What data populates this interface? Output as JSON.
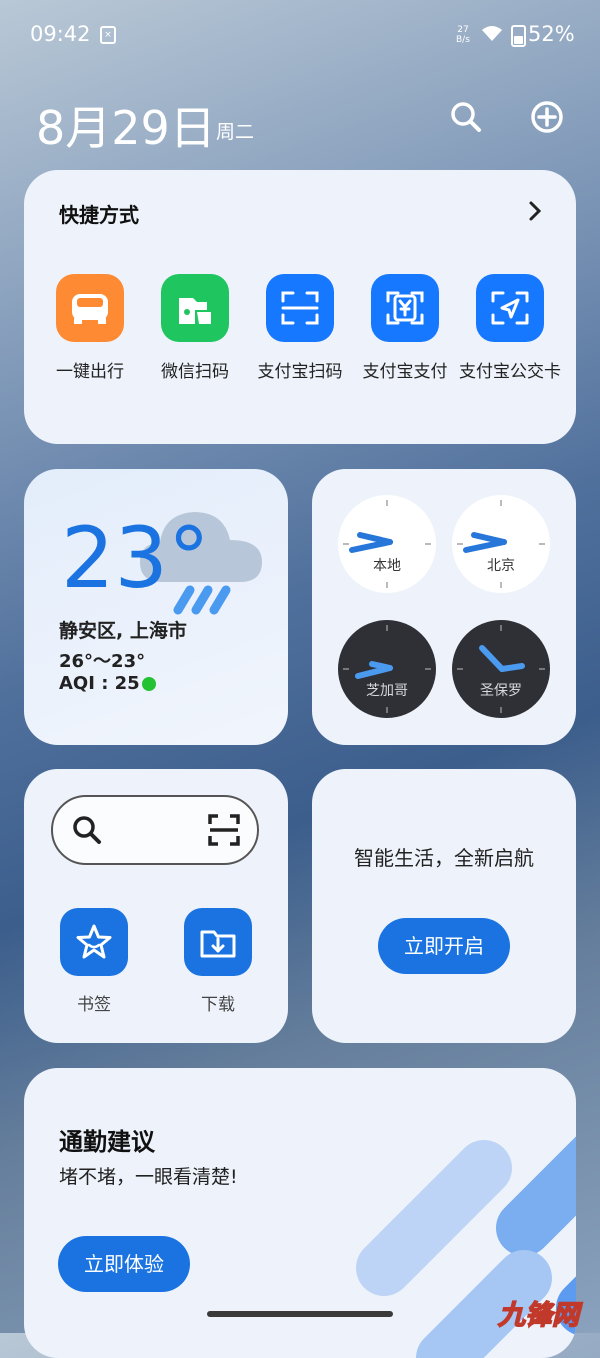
{
  "status_bar": {
    "time": "09:42",
    "speed_value": "27",
    "speed_unit": "B/s",
    "battery": "52%"
  },
  "header": {
    "date": "8月29日",
    "weekday": "周二",
    "search_icon": "search-icon",
    "add_icon": "add-circle-icon"
  },
  "shortcuts": {
    "title": "快捷方式",
    "items": [
      {
        "label": "一键出行",
        "icon": "car-icon",
        "color": "#ff8a34"
      },
      {
        "label": "微信扫码",
        "icon": "wechat-scan-icon",
        "color": "#1fc660"
      },
      {
        "label": "支付宝扫码",
        "icon": "scan-icon",
        "color": "#1677ff"
      },
      {
        "label": "支付宝支付",
        "icon": "yuan-pay-icon",
        "color": "#1677ff"
      },
      {
        "label": "支付宝公交卡",
        "icon": "bus-card-icon",
        "color": "#1677ff"
      }
    ]
  },
  "weather": {
    "temperature": "23°",
    "location": "静安区, 上海市",
    "range": "26°～23°",
    "aqi": "AQI : 25",
    "aqi_color": "#22c232"
  },
  "world_clock": [
    {
      "label": "本地",
      "theme": "light"
    },
    {
      "label": "北京",
      "theme": "light"
    },
    {
      "label": "芝加哥",
      "theme": "dark"
    },
    {
      "label": "圣保罗",
      "theme": "dark"
    }
  ],
  "browser": {
    "bookmark_label": "书签",
    "download_label": "下载"
  },
  "smart_life": {
    "text": "智能生活，全新启航",
    "button": "立即开启"
  },
  "commute": {
    "title": "通勤建议",
    "subtitle": "堵不堵，一眼看清楚!",
    "button": "立即体验"
  },
  "accent_color": "#1a73e0",
  "watermark": "九锋网"
}
